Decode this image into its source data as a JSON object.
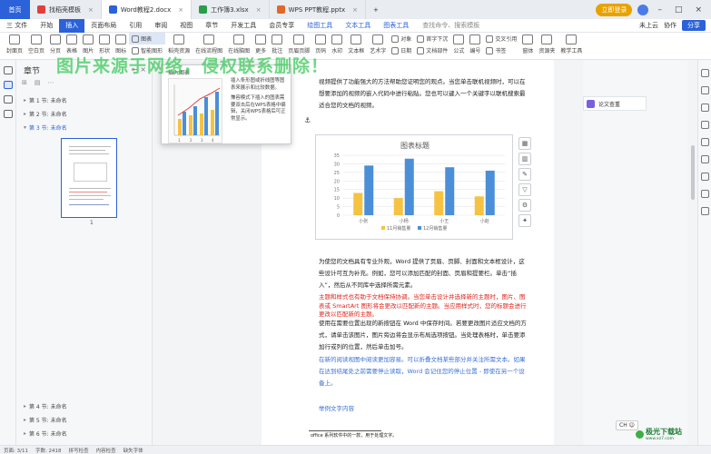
{
  "titlebar": {
    "home": "首页",
    "tabs": [
      {
        "label": "找稻壳模板",
        "color": "#e0403a",
        "active": false
      },
      {
        "label": "Word教程2.docx",
        "color": "#2b62d9",
        "active": true
      },
      {
        "label": "工作簿3.xlsx",
        "color": "#2a9d4a",
        "active": false
      },
      {
        "label": "WPS PPT教程.pptx",
        "color": "#e0682a",
        "active": false
      }
    ],
    "login": "立即登录"
  },
  "menubar": {
    "file": "三 文件",
    "items": [
      "开始",
      "插入",
      "页面布局",
      "引用",
      "审阅",
      "视图",
      "章节",
      "开发工具",
      "会员专享"
    ],
    "active": "插入",
    "context": [
      "绘图工具",
      "文本工具",
      "图表工具"
    ],
    "search": "查找命令、搜索模板",
    "right": [
      "未上云",
      "协作"
    ],
    "share": "分享"
  },
  "ribbon": {
    "left": [
      "封面页",
      "空白页",
      "分页",
      "表格",
      "图片",
      "形状",
      "图标",
      "图表",
      "智能图形",
      "稻壳资源",
      "在线流程图",
      "在线脑图",
      "更多",
      "批注",
      "页眉页脚",
      "页码",
      "水印",
      "文本框",
      "艺术字",
      "日期",
      "附件",
      "文档部件",
      "公式",
      "编号",
      "交叉引用",
      "书签",
      "窗体",
      "资源夹",
      "教学工具"
    ],
    "chart_btn": "图表",
    "smart_btn": "智能图形",
    "object_btn": "对象",
    "dropcap": "首字下沉"
  },
  "watermark": "图片来源于网络，侵权联系删除！",
  "nav": {
    "title": "章节",
    "items": [
      {
        "label": "第 1 节: 未命名",
        "active": false
      },
      {
        "label": "第 2 节: 未命名",
        "active": false
      },
      {
        "label": "第 3 节: 未命名",
        "active": true
      },
      {
        "label": "第 4 节: 未命名",
        "active": false
      },
      {
        "label": "第 5 节: 未命名",
        "active": false
      },
      {
        "label": "第 6 节: 未命名",
        "active": false
      }
    ],
    "page_num": "1"
  },
  "popup": {
    "title": "插入图表",
    "desc1": "插入条形图或折线图等图表来展示和比较数据。",
    "desc2": "兼容模式下插入的图表需要双击后在WPS表格中编辑，关闭WPS表格后可正常显示。"
  },
  "document": {
    "p1": "视频提供了功能强大的方法帮助您证明您的观点。当您单击联机视频时，可以在想要添加的视频的嵌入代码中进行粘贴。您也可以键入一个关键字以联机搜索最适合您的文档的视频。",
    "p2": "为使您的文档具有专业外观，Word 提供了页眉、页脚、封面和文本框设计，这些设计可互为补充。例如，您可以添加匹配的封面、页眉和提要栏。单击“插入”，然后从不同库中选择所需元素。",
    "p3": "主题和样式也有助于文档保持协调。当您单击设计并选择新的主题时，图片、图表或 SmartArt 图形将会更改以匹配新的主题。当应用样式时，您的标题会进行更改以匹配新的主题。",
    "p4": "使用在需要位置出现的新按钮在 Word 中保存时间。若要更改图片适应文档的方式，请单击该图片，图片旁边将会显示布局选项按钮。当处理表格时，单击要添加行或列的位置，然后单击加号。",
    "p5": "在新的阅读视图中阅读更加容易。可以折叠文档某些部分并关注所需文本。如果在达到结尾处之前需要停止读取，Word 会记住您的停止位置 - 即使在另一个设备上。",
    "p6": "举例文字内容",
    "footnote": "office 系列软件中的一款，用于处理文字。"
  },
  "chart_data": {
    "type": "bar",
    "title": "图表标题",
    "categories": [
      "小张",
      "小杨",
      "小王",
      "小赵"
    ],
    "series": [
      {
        "name": "11月销售量",
        "values": [
          13,
          10,
          14,
          11
        ],
        "color": "#f5c242"
      },
      {
        "name": "12月销售量",
        "values": [
          29,
          33,
          28,
          26
        ],
        "color": "#4a8fd8"
      }
    ],
    "ylim": [
      0,
      35
    ],
    "ticks": [
      0,
      5,
      10,
      15,
      20,
      25,
      30,
      35
    ],
    "grid": true,
    "legend": "bottom"
  },
  "right_panel": {
    "check": "论文查重"
  },
  "status": {
    "page": "页面: 3/11",
    "words": "字数: 2418",
    "spell": "拼写检查",
    "content": "内容检查",
    "missing": "缺失字体"
  },
  "badge": "CH",
  "logo": {
    "text": "极光下载站",
    "url": "www.xz7.com"
  }
}
